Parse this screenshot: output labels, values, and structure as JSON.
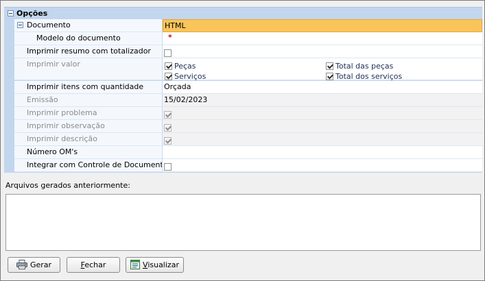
{
  "category": {
    "label": "Opções"
  },
  "rows": {
    "documento": {
      "name": "Documento",
      "value": "HTML"
    },
    "modelo": {
      "name": "Modelo do documento",
      "required_mark": "*"
    },
    "imprimir_resumo": {
      "name": "Imprimir resumo com totalizador",
      "checked": false
    },
    "imprimir_valor": {
      "name": "Imprimir valor",
      "options": [
        {
          "label": "Peças",
          "checked": true
        },
        {
          "label": "Total das peças",
          "checked": true
        },
        {
          "label": "Serviços",
          "checked": true
        },
        {
          "label": "Total dos serviços",
          "checked": true
        }
      ]
    },
    "imprimir_itens": {
      "name": "Imprimir itens com quantidade",
      "value": "Orçada"
    },
    "emissao": {
      "name": "Emissão",
      "value": "15/02/2023"
    },
    "imprimir_problema": {
      "name": "Imprimir problema",
      "checked": true
    },
    "imprimir_observacao": {
      "name": "Imprimir observação",
      "checked": true
    },
    "imprimir_descricao": {
      "name": "Imprimir descrição",
      "checked": true
    },
    "numero_om": {
      "name": "Número OM's",
      "value": ""
    },
    "integrar": {
      "name": "Integrar com Controle de Documentos",
      "checked": false
    }
  },
  "files": {
    "label": "Arquivos gerados anteriormente:"
  },
  "buttons": {
    "gerar": {
      "label": "Gerar",
      "icon": "printer-icon"
    },
    "fechar": {
      "label": "Fechar",
      "accel": "F",
      "rest": "echar"
    },
    "visualizar": {
      "label": "Visualizar",
      "accel": "V",
      "rest": "isualizar",
      "icon": "preview-icon"
    }
  }
}
